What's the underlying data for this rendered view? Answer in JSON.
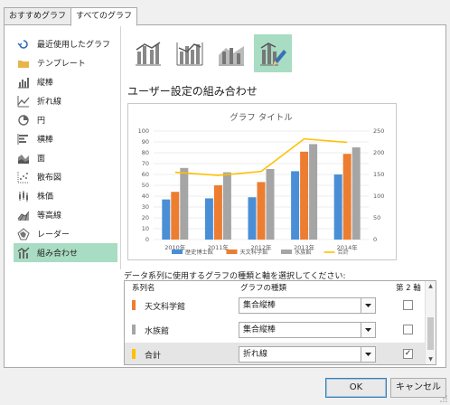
{
  "tabs": [
    "おすすめグラフ",
    "すべてのグラフ"
  ],
  "sidebar": {
    "items": [
      {
        "label": "最近使用したグラフ",
        "icon": "recent-icon"
      },
      {
        "label": "テンプレート",
        "icon": "folder-icon"
      },
      {
        "label": "縦棒",
        "icon": "column-chart-icon"
      },
      {
        "label": "折れ線",
        "icon": "line-chart-icon"
      },
      {
        "label": "円",
        "icon": "pie-chart-icon"
      },
      {
        "label": "横棒",
        "icon": "bar-chart-icon"
      },
      {
        "label": "面",
        "icon": "area-chart-icon"
      },
      {
        "label": "散布図",
        "icon": "scatter-chart-icon"
      },
      {
        "label": "株価",
        "icon": "stock-chart-icon"
      },
      {
        "label": "等高線",
        "icon": "surface-chart-icon"
      },
      {
        "label": "レーダー",
        "icon": "radar-chart-icon"
      },
      {
        "label": "組み合わせ",
        "icon": "combo-chart-icon"
      }
    ]
  },
  "section_title": "ユーザー設定の組み合わせ",
  "chart_data": {
    "type": "bar",
    "title": "グラフ タイトル",
    "categories": [
      "2010年",
      "2011年",
      "2012年",
      "2013年",
      "2014年"
    ],
    "series": [
      {
        "name": "歴史博士館",
        "type": "bar",
        "axis": "primary",
        "color": "#4a8fd6",
        "values": [
          37,
          38,
          39,
          63,
          60
        ]
      },
      {
        "name": "天文科学館",
        "type": "bar",
        "axis": "primary",
        "color": "#ed7d31",
        "values": [
          44,
          50,
          53,
          81,
          79
        ]
      },
      {
        "name": "水族館",
        "type": "bar",
        "axis": "primary",
        "color": "#a5a5a5",
        "values": [
          66,
          62,
          65,
          88,
          85
        ]
      },
      {
        "name": "合計",
        "type": "line",
        "axis": "secondary",
        "color": "#ffc000",
        "values": [
          155,
          148,
          157,
          232,
          224
        ]
      }
    ],
    "y_primary": {
      "min": 0,
      "max": 100,
      "ticks": [
        "0",
        "10",
        "20",
        "30",
        "40",
        "50",
        "60",
        "70",
        "80",
        "90",
        "100"
      ]
    },
    "y_secondary": {
      "min": 0,
      "max": 250,
      "ticks": [
        "0",
        "50",
        "100",
        "150",
        "200",
        "250"
      ]
    },
    "legend_position": "bottom",
    "grid": true
  },
  "instruction": "データ系列に使用するグラフの種類と軸を選択してください:",
  "grid_headers": {
    "name": "系列名",
    "type": "グラフの種類",
    "axis": "第 2 軸"
  },
  "series_rows": [
    {
      "name": "天文科学館",
      "color": "#ed7d31",
      "chart_type": "集合縦棒",
      "secondary": false
    },
    {
      "name": "水族館",
      "color": "#a5a5a5",
      "chart_type": "集合縦棒",
      "secondary": false
    },
    {
      "name": "合計",
      "color": "#ffc000",
      "chart_type": "折れ線",
      "secondary": true
    }
  ],
  "buttons": {
    "ok": "OK",
    "cancel": "キャンセル"
  }
}
